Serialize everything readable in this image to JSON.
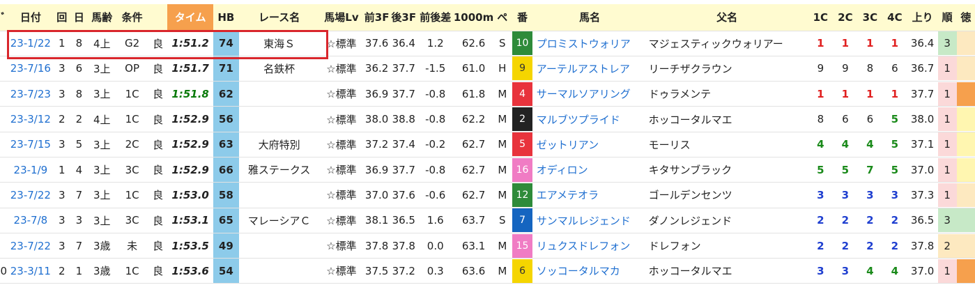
{
  "colors": {
    "header_bg": "#fffbd0",
    "time_header_bg": "#f6a04d",
    "hb_bg": "#8dcbea",
    "link": "#1f6fd0",
    "highlight_box": "#d9262c",
    "corner_red": "#e02020",
    "corner_green": "#1a8a1a",
    "corner_blue": "#1f3fd0",
    "frame": {
      "1": "#ffffff",
      "2": "#222222",
      "3": "#e8333c",
      "4": "#1565c0",
      "5": "#f5d500",
      "6": "#2e8b3a",
      "7": "#f08a24",
      "8": "#f07cc4"
    },
    "rank": {
      "1": "#fbd9d9",
      "2": "#fde9c0",
      "3": "#c7e9c7"
    }
  },
  "headers": {
    "edge_left": "ﾞ",
    "date": "日付",
    "kai": "回",
    "day": "日",
    "age": "馬齢",
    "cond": "条件",
    "track": "",
    "time": "タイム",
    "hb": "HB",
    "race": "レース名",
    "baba": "馬場Lv",
    "f3": "前3F",
    "l3": "後3F",
    "diff": "前後差",
    "m1000": "1000m",
    "pace": "ペ",
    "ban": "番",
    "horse": "馬名",
    "sire": "父名",
    "c1": "1C",
    "c2": "2C",
    "c3": "3C",
    "c4": "4C",
    "agari": "上り",
    "rank": "順",
    "edge_right": "徳"
  },
  "rows": [
    {
      "edge": "",
      "date": "23-1/22",
      "kai": "1",
      "day": "8",
      "age": "4上",
      "cond": "G2",
      "track": "良",
      "time": "1:51.2",
      "time_green": false,
      "hb": "74",
      "race": "東海Ｓ",
      "baba": "☆標準",
      "f3": "37.6",
      "l3": "36.4",
      "diff": "1.2",
      "m1000": "62.6",
      "pace": "S",
      "ban": "10",
      "frame": "6",
      "horse": "プロミストウォリア",
      "sire": "マジェスティックウォリアー",
      "c1": "1",
      "c2": "1",
      "c3": "1",
      "c4": "1",
      "corner_color": "red",
      "agari": "36.4",
      "rank": "3",
      "last": ""
    },
    {
      "edge": "",
      "date": "23-7/16",
      "kai": "3",
      "day": "6",
      "age": "3上",
      "cond": "OP",
      "track": "良",
      "time": "1:51.7",
      "time_green": false,
      "hb": "71",
      "race": "名鉄杯",
      "baba": "☆標準",
      "f3": "36.2",
      "l3": "37.7",
      "diff": "-1.5",
      "m1000": "61.0",
      "pace": "H",
      "ban": "9",
      "frame": "5",
      "horse": "アーテルアストレア",
      "sire": "リーチザクラウン",
      "c1": "9",
      "c2": "9",
      "c3": "8",
      "c4": "6",
      "corner_color": "plain",
      "agari": "36.7",
      "rank": "1",
      "last": ""
    },
    {
      "edge": "",
      "date": "23-7/23",
      "kai": "3",
      "day": "8",
      "age": "3上",
      "cond": "1C",
      "track": "良",
      "time": "1:51.8",
      "time_green": true,
      "hb": "62",
      "race": "",
      "baba": "☆標準",
      "f3": "36.9",
      "l3": "37.7",
      "diff": "-0.8",
      "m1000": "61.8",
      "pace": "M",
      "ban": "4",
      "frame": "3",
      "horse": "サーマルソアリング",
      "sire": "ドゥラメンテ",
      "c1": "1",
      "c2": "1",
      "c3": "1",
      "c4": "1",
      "corner_color": "red",
      "agari": "37.7",
      "rank": "1",
      "last": ""
    },
    {
      "edge": "",
      "date": "23-3/12",
      "kai": "2",
      "day": "2",
      "age": "4上",
      "cond": "1C",
      "track": "良",
      "time": "1:52.9",
      "time_green": false,
      "hb": "56",
      "race": "",
      "baba": "☆標準",
      "f3": "38.0",
      "l3": "38.8",
      "diff": "-0.8",
      "m1000": "62.2",
      "pace": "M",
      "ban": "2",
      "frame": "2",
      "horse": "マルブツプライド",
      "sire": "ホッコータルマエ",
      "c1": "8",
      "c2": "6",
      "c3": "6",
      "c4": "5",
      "corner_color": "mixed5",
      "agari": "38.0",
      "rank": "1",
      "last": ""
    },
    {
      "edge": "",
      "date": "23-7/15",
      "kai": "3",
      "day": "5",
      "age": "3上",
      "cond": "2C",
      "track": "良",
      "time": "1:52.9",
      "time_green": false,
      "hb": "63",
      "race": "大府特別",
      "baba": "☆標準",
      "f3": "37.2",
      "l3": "37.4",
      "diff": "-0.2",
      "m1000": "62.7",
      "pace": "M",
      "ban": "5",
      "frame": "3",
      "horse": "ゼットリアン",
      "sire": "モーリス",
      "c1": "4",
      "c2": "4",
      "c3": "4",
      "c4": "5",
      "corner_color": "green",
      "agari": "37.1",
      "rank": "1",
      "last": ""
    },
    {
      "edge": "",
      "date": "23-1/9",
      "kai": "1",
      "day": "4",
      "age": "3上",
      "cond": "3C",
      "track": "良",
      "time": "1:52.9",
      "time_green": false,
      "hb": "66",
      "race": "雅ステークス",
      "baba": "☆標準",
      "f3": "36.9",
      "l3": "37.7",
      "diff": "-0.8",
      "m1000": "62.7",
      "pace": "M",
      "ban": "16",
      "frame": "8",
      "horse": "オディロン",
      "sire": "キタサンブラック",
      "c1": "5",
      "c2": "5",
      "c3": "7",
      "c4": "5",
      "corner_color": "green",
      "agari": "37.0",
      "rank": "1",
      "last": ""
    },
    {
      "edge": "",
      "date": "23-7/22",
      "kai": "3",
      "day": "7",
      "age": "3上",
      "cond": "1C",
      "track": "良",
      "time": "1:53.0",
      "time_green": false,
      "hb": "58",
      "race": "",
      "baba": "☆標準",
      "f3": "37.0",
      "l3": "37.6",
      "diff": "-0.6",
      "m1000": "62.7",
      "pace": "M",
      "ban": "12",
      "frame": "6",
      "horse": "エアメテオラ",
      "sire": "ゴールデンセンツ",
      "c1": "3",
      "c2": "3",
      "c3": "3",
      "c4": "3",
      "corner_color": "blue",
      "agari": "37.3",
      "rank": "1",
      "last": ""
    },
    {
      "edge": "",
      "date": "23-7/8",
      "kai": "3",
      "day": "3",
      "age": "3上",
      "cond": "3C",
      "track": "良",
      "time": "1:53.1",
      "time_green": false,
      "hb": "65",
      "race": "マレーシアＣ",
      "baba": "☆標準",
      "f3": "38.1",
      "l3": "36.5",
      "diff": "1.6",
      "m1000": "63.7",
      "pace": "S",
      "ban": "7",
      "frame": "4",
      "horse": "サンマルレジェンド",
      "sire": "ダノンレジェンド",
      "c1": "2",
      "c2": "2",
      "c3": "2",
      "c4": "2",
      "corner_color": "blue",
      "agari": "36.5",
      "rank": "3",
      "last": ""
    },
    {
      "edge": "",
      "date": "23-7/22",
      "kai": "3",
      "day": "7",
      "age": "3歳",
      "cond": "未",
      "track": "良",
      "time": "1:53.5",
      "time_green": false,
      "hb": "49",
      "race": "",
      "baba": "☆標準",
      "f3": "37.8",
      "l3": "37.8",
      "diff": "0.0",
      "m1000": "63.1",
      "pace": "M",
      "ban": "15",
      "frame": "8",
      "horse": "リュクスドレフォン",
      "sire": "ドレフォン",
      "c1": "2",
      "c2": "2",
      "c3": "2",
      "c4": "2",
      "corner_color": "blue",
      "agari": "37.8",
      "rank": "2",
      "last": ""
    },
    {
      "edge": "0",
      "date": "23-3/11",
      "kai": "2",
      "day": "1",
      "age": "3歳",
      "cond": "1C",
      "track": "良",
      "time": "1:53.6",
      "time_green": false,
      "hb": "54",
      "race": "",
      "baba": "☆標準",
      "f3": "37.5",
      "l3": "37.2",
      "diff": "0.3",
      "m1000": "63.6",
      "pace": "M",
      "ban": "6",
      "frame": "5",
      "horse": "ソッコータルマカ",
      "sire": "ホッコータルマエ",
      "c1": "3",
      "c2": "3",
      "c3": "4",
      "c4": "4",
      "corner_color": "mixed34",
      "agari": "37.0",
      "rank": "1",
      "last": ""
    }
  ]
}
